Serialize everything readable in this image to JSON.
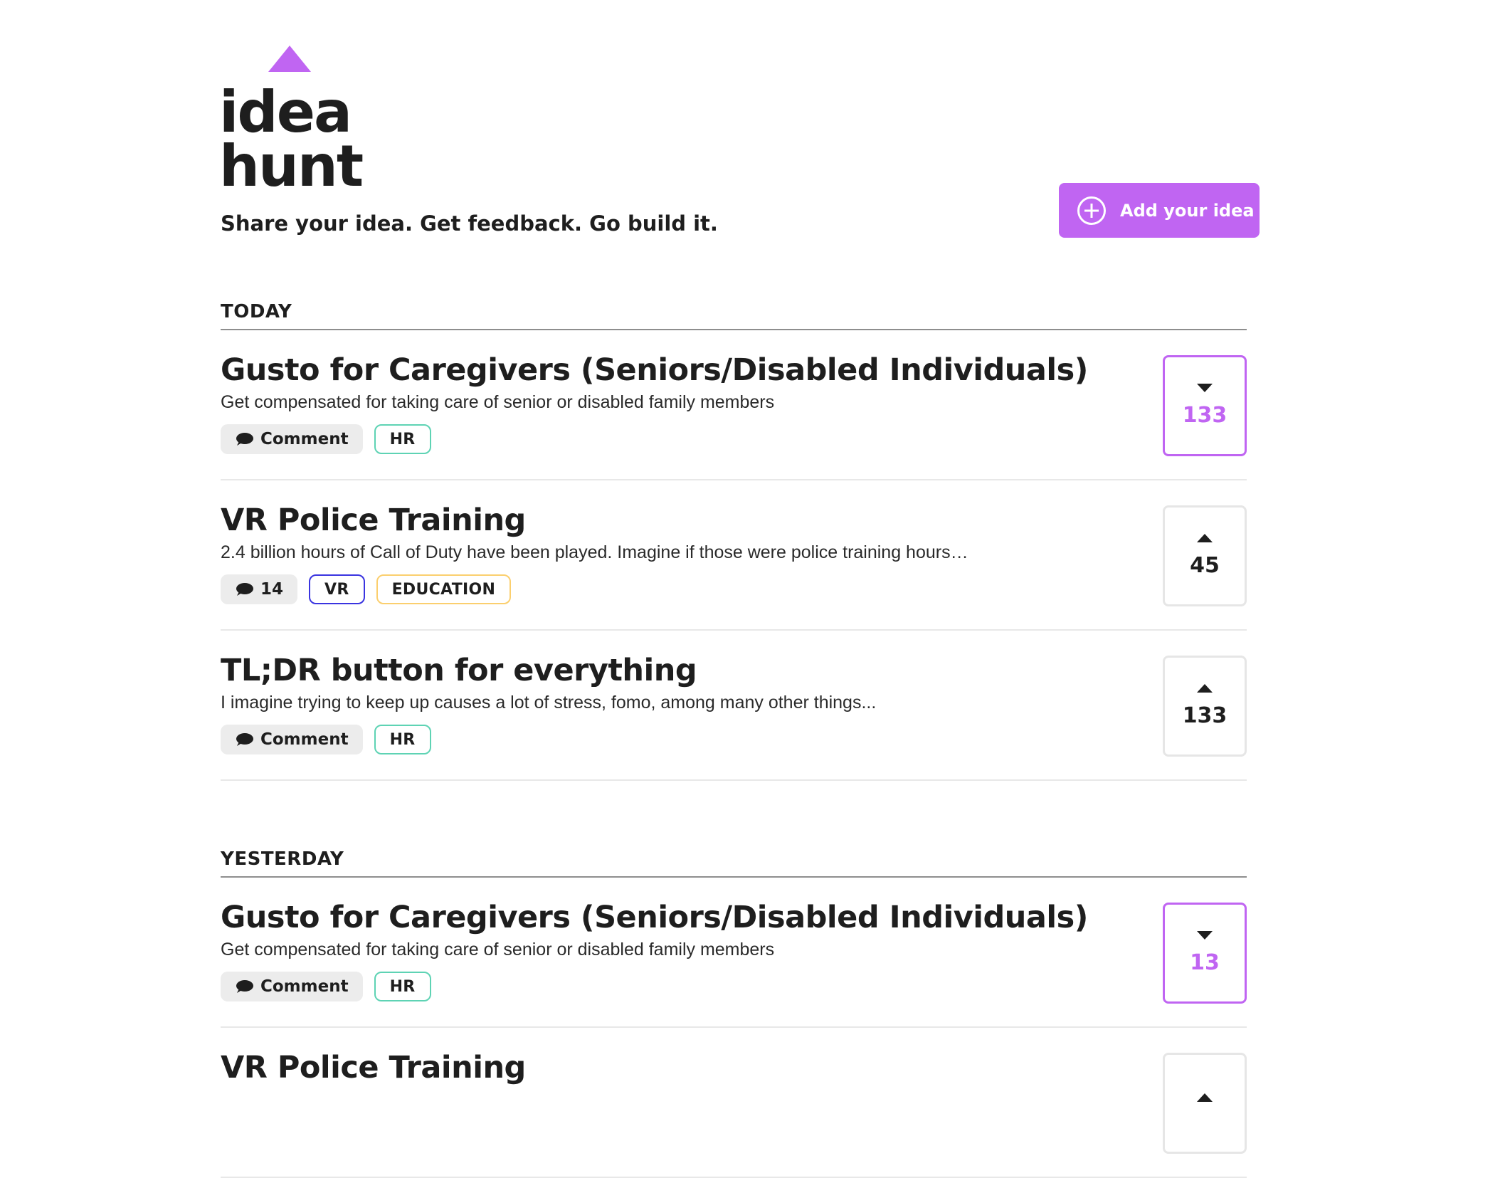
{
  "header": {
    "logo_line1": "idea",
    "logo_line2": "hunt",
    "tagline": "Share your idea. Get feedback. Go build it.",
    "add_button_label": "Add your idea"
  },
  "colors": {
    "accent": "#c065f2",
    "text": "#1e1e1e",
    "tag_hr": "#5ed3b4",
    "tag_vr": "#3a34e0",
    "tag_education": "#fbcf6e"
  },
  "sections": [
    {
      "title": "TODAY",
      "ideas": [
        {
          "title": "Gusto for Caregivers (Seniors/Disabled Individuals)",
          "description": "Get compensated for taking care of senior or disabled family members",
          "comment_label": "Comment",
          "tags": [
            "HR"
          ],
          "votes": "133",
          "voted": true,
          "arrow": "down"
        },
        {
          "title": "VR Police Training",
          "description": "2.4 billion hours of Call of Duty have been played. Imagine if those were police training hours…",
          "comment_label": "14",
          "tags": [
            "VR",
            "EDUCATION"
          ],
          "votes": "45",
          "voted": false,
          "arrow": "up"
        },
        {
          "title": "TL;DR button for everything",
          "description": "I imagine trying to keep up causes a lot of stress, fomo, among many other things...",
          "comment_label": "Comment",
          "tags": [
            "HR"
          ],
          "votes": "133",
          "voted": false,
          "arrow": "up"
        }
      ]
    },
    {
      "title": "YESTERDAY",
      "ideas": [
        {
          "title": "Gusto for Caregivers (Seniors/Disabled Individuals)",
          "description": "Get compensated for taking care of senior or disabled family members",
          "comment_label": "Comment",
          "tags": [
            "HR"
          ],
          "votes": "13",
          "voted": true,
          "arrow": "down"
        },
        {
          "title": "VR Police Training",
          "description": "",
          "comment_label": "",
          "tags": [],
          "votes": "",
          "voted": false,
          "arrow": "up"
        }
      ]
    }
  ]
}
